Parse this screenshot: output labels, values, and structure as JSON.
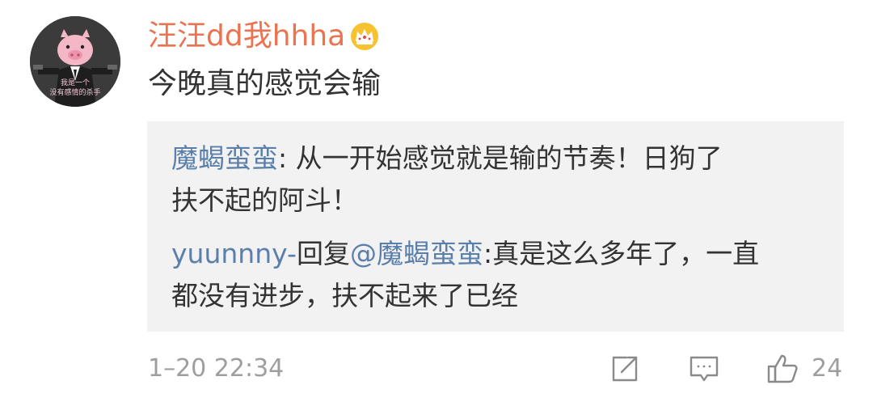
{
  "comment": {
    "avatar_text_line1": "我是一个",
    "avatar_text_line2": "没有感情的杀手",
    "username": "汪汪dd我hhha",
    "user_badge_icon": "crown-icon",
    "text": "今晚真的感觉会输",
    "accent_color": "#eb7350",
    "link_color": "#5b7fab"
  },
  "replies": [
    {
      "author": "魔蝎蛮蛮",
      "separator": ": ",
      "text_line1": "从一开始感觉就是输的节奏！日狗了",
      "text_line2": "扶不起的阿斗！"
    },
    {
      "author": "yuunnny-",
      "reply_word": "回复",
      "mention": "@魔蝎蛮蛮",
      "separator": ":",
      "text_line1": "真是这么多年了，一直",
      "text_line2": "都没有进步，扶不起来了已经"
    }
  ],
  "footer": {
    "timestamp": "1–20 22:34",
    "share_icon": "share-icon",
    "reply_icon": "comment-icon",
    "like_icon": "thumbs-up-icon",
    "like_count": "24"
  }
}
